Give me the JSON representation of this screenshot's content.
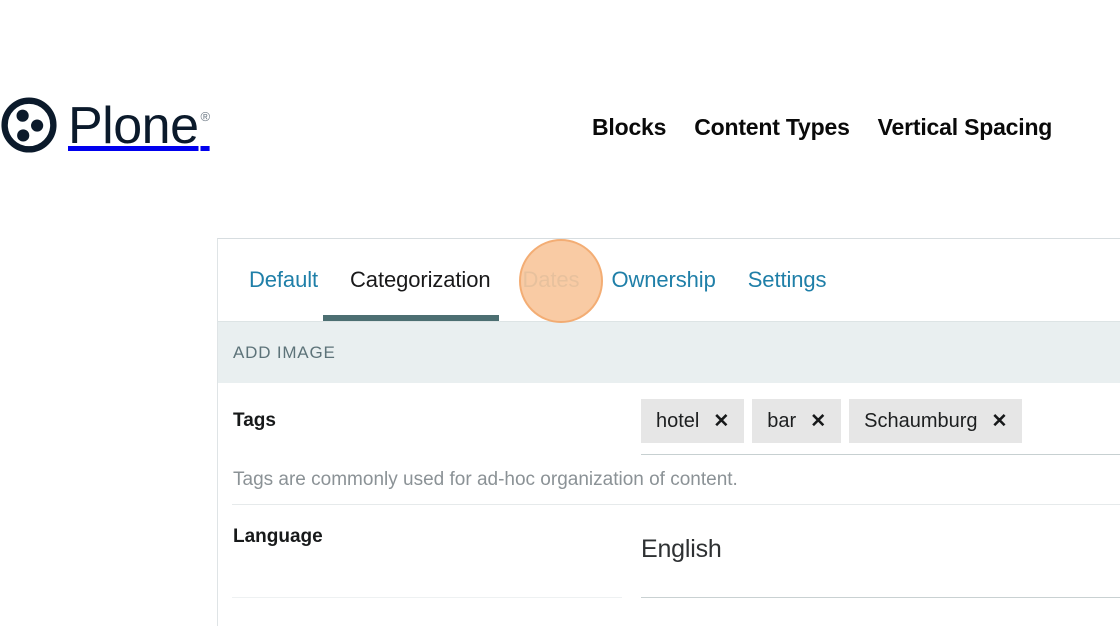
{
  "site": {
    "brand": {
      "logo_icon": "plone-circle-dots-icon",
      "name": "Plone",
      "registered_mark": "®"
    },
    "nav": [
      {
        "label": "Blocks"
      },
      {
        "label": "Content Types"
      },
      {
        "label": "Vertical Spacing"
      }
    ]
  },
  "panel": {
    "tabs": [
      {
        "label": "Default",
        "active": false
      },
      {
        "label": "Categorization",
        "active": true
      },
      {
        "label": "Dates",
        "active": false
      },
      {
        "label": "Ownership",
        "active": false
      },
      {
        "label": "Settings",
        "active": false
      }
    ],
    "section_band": {
      "label": "ADD IMAGE"
    },
    "fields": {
      "tags": {
        "label": "Tags",
        "chips": [
          {
            "label": "hotel",
            "remove_icon": "✕"
          },
          {
            "label": "bar",
            "remove_icon": "✕"
          },
          {
            "label": "Schaumburg",
            "remove_icon": "✕"
          }
        ],
        "help": "Tags are commonly used for ad-hoc organization of content."
      },
      "language": {
        "label": "Language",
        "value": "English"
      }
    }
  },
  "cursor": {
    "target_tab": "Dates",
    "highlight_color": "#f9c79d",
    "highlight_border_color": "#f3a769"
  },
  "colors": {
    "link_blue": "#1f7fa8",
    "active_tab_underline": "#4c6f72",
    "section_band_bg": "#e9eff0",
    "chip_bg": "#e6e6e6",
    "brand_dark": "#0b1a2b"
  }
}
